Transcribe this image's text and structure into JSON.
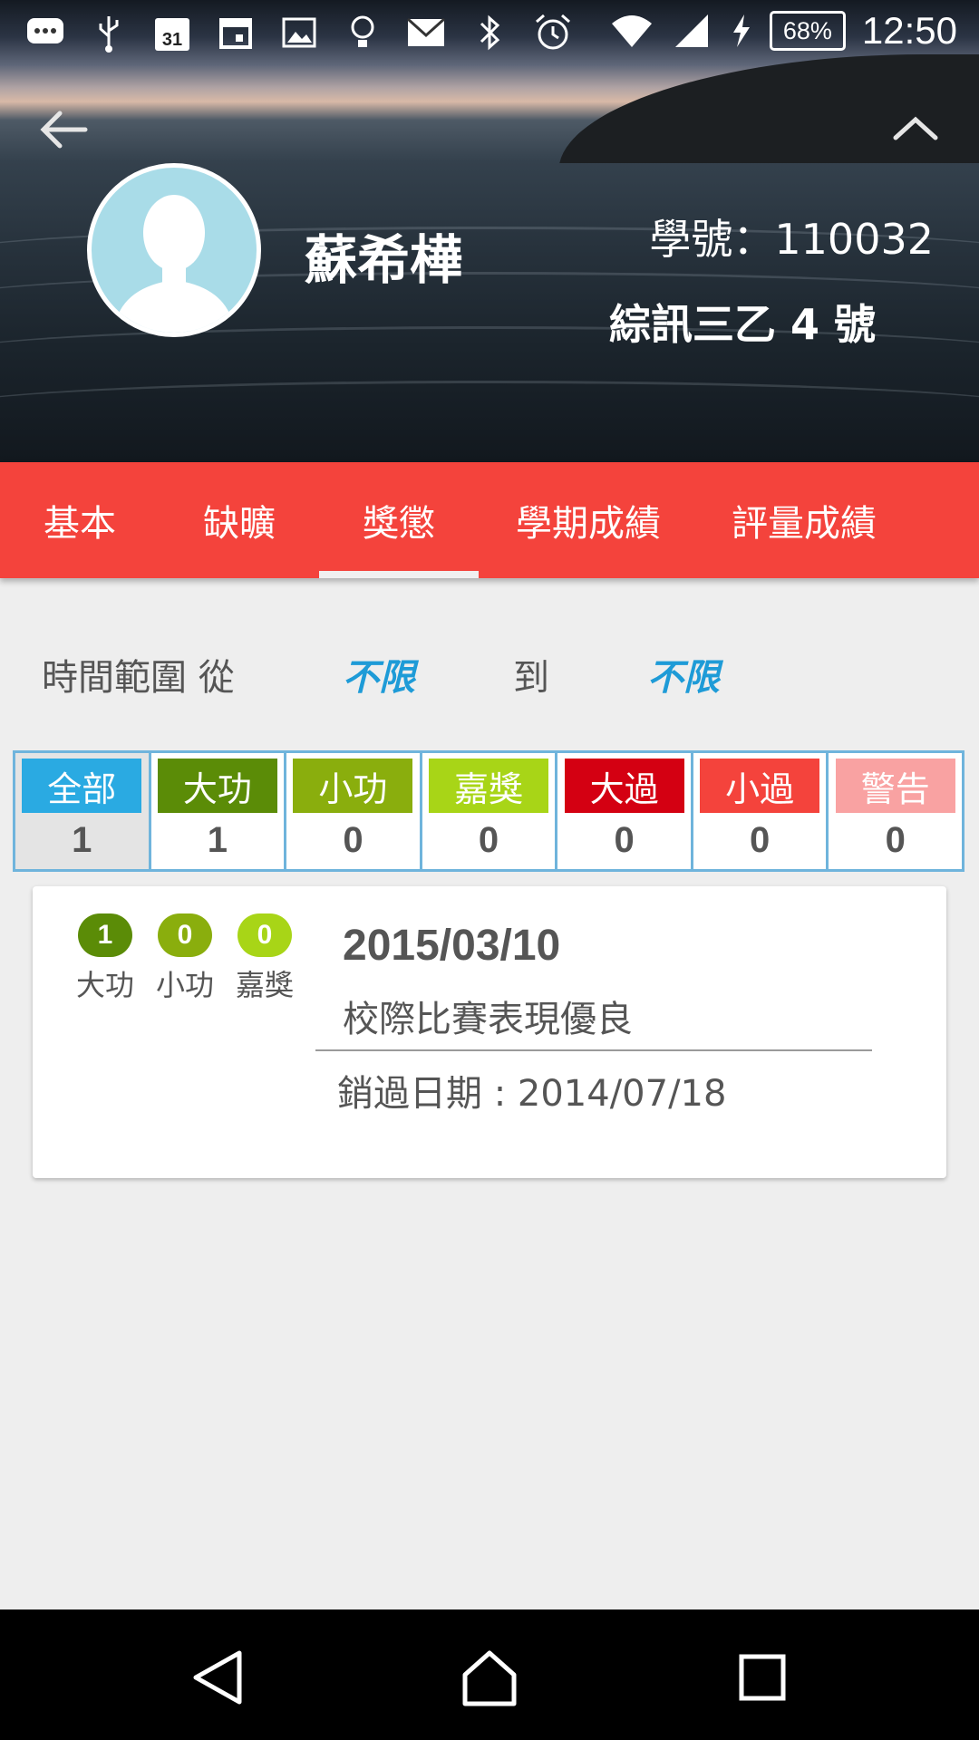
{
  "status_bar": {
    "battery": "68%",
    "time": "12:50",
    "icons": [
      "chat-icon",
      "usb-icon",
      "calendar-31-icon",
      "calendar-icon",
      "image-icon",
      "bulb-icon",
      "mail-icon",
      "bluetooth-icon",
      "alarm-icon",
      "wifi-icon",
      "signal-icon",
      "charging-icon"
    ]
  },
  "header": {
    "name": "蘇希樺",
    "student_id": "學號：110032",
    "class_info": "綜訊三乙 4 號"
  },
  "tabs": [
    {
      "label": "基本",
      "active": false
    },
    {
      "label": "缺曠",
      "active": false
    },
    {
      "label": "獎懲",
      "active": true
    },
    {
      "label": "學期成績",
      "active": false
    },
    {
      "label": "評量成績",
      "active": false
    }
  ],
  "time_range": {
    "label": "時間範圍  從",
    "from": "不限",
    "to_label": "到",
    "to": "不限"
  },
  "categories": [
    {
      "label": "全部",
      "count": "1",
      "color": "#2aaae2",
      "selected": true
    },
    {
      "label": "大功",
      "count": "1",
      "color": "#5b8c07",
      "selected": false
    },
    {
      "label": "小功",
      "count": "0",
      "color": "#8aae0d",
      "selected": false
    },
    {
      "label": "嘉獎",
      "count": "0",
      "color": "#a8d517",
      "selected": false
    },
    {
      "label": "大過",
      "count": "0",
      "color": "#d40012",
      "selected": false
    },
    {
      "label": "小過",
      "count": "0",
      "color": "#f4433c",
      "selected": false
    },
    {
      "label": "警告",
      "count": "0",
      "color": "#f9a2a2",
      "selected": false
    }
  ],
  "record": {
    "badges": [
      {
        "count": "1",
        "name": "大功",
        "color": "#5b8c07"
      },
      {
        "count": "0",
        "name": "小功",
        "color": "#8aae0d"
      },
      {
        "count": "0",
        "name": "嘉獎",
        "color": "#a8d517"
      }
    ],
    "date": "2015/03/10",
    "description": "校際比賽表現優良",
    "cleared": "銷過日期 : 2014/07/18"
  },
  "navbar": {
    "icons": [
      "back-triangle-icon",
      "home-icon",
      "recents-icon"
    ]
  }
}
